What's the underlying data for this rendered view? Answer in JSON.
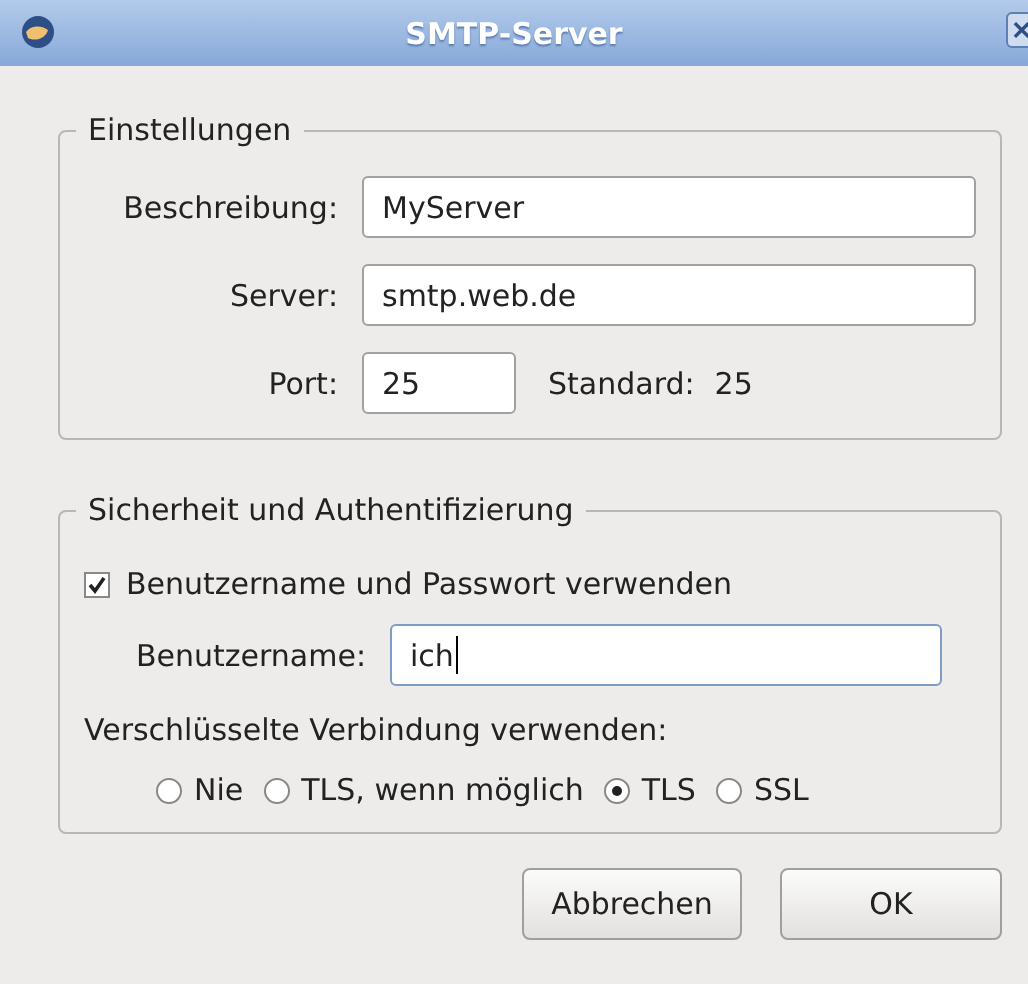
{
  "window": {
    "title": "SMTP-Server"
  },
  "settings": {
    "legend": "Einstellungen",
    "description": {
      "label": "Beschreibung:",
      "value": "MyServer"
    },
    "server": {
      "label": "Server:",
      "value": "smtp.web.de"
    },
    "port": {
      "label": "Port:",
      "value": "25"
    },
    "default_label": "Standard:",
    "default_value": "25"
  },
  "security": {
    "legend": "Sicherheit und Authentifizierung",
    "use_auth": {
      "label": "Benutzername und Passwort verwenden",
      "checked": true
    },
    "username": {
      "label": "Benutzername:",
      "value": "ich",
      "focused": true
    },
    "encryption": {
      "label": "Verschlüsselte Verbindung verwenden:",
      "options": [
        {
          "label": "Nie",
          "selected": false
        },
        {
          "label": "TLS, wenn möglich",
          "selected": false
        },
        {
          "label": "TLS",
          "selected": true
        },
        {
          "label": "SSL",
          "selected": false
        }
      ]
    }
  },
  "buttons": [
    "Abbrechen",
    "OK"
  ]
}
